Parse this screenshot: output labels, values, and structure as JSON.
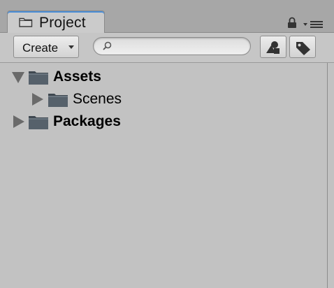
{
  "tab": {
    "title": "Project",
    "icon": "folder-icon"
  },
  "tab_controls": {
    "lock_icon": "lock-icon",
    "menu_icon": "tab-menu-icon"
  },
  "toolbar": {
    "create_label": "Create",
    "search_placeholder": "",
    "search_value": "",
    "search_icon": "search-icon",
    "filter_type_icon": "shapes-icon",
    "filter_label_icon": "tag-icon"
  },
  "tree": {
    "items": [
      {
        "label": "Assets",
        "expanded": true,
        "bold": true,
        "depth": 0
      },
      {
        "label": "Scenes",
        "expanded": false,
        "bold": false,
        "depth": 1
      },
      {
        "label": "Packages",
        "expanded": false,
        "bold": true,
        "depth": 0
      }
    ]
  },
  "colors": {
    "panel_bg": "#c2c2c2",
    "tab_accent": "#4a8dd6",
    "folder": "#4f5961"
  }
}
